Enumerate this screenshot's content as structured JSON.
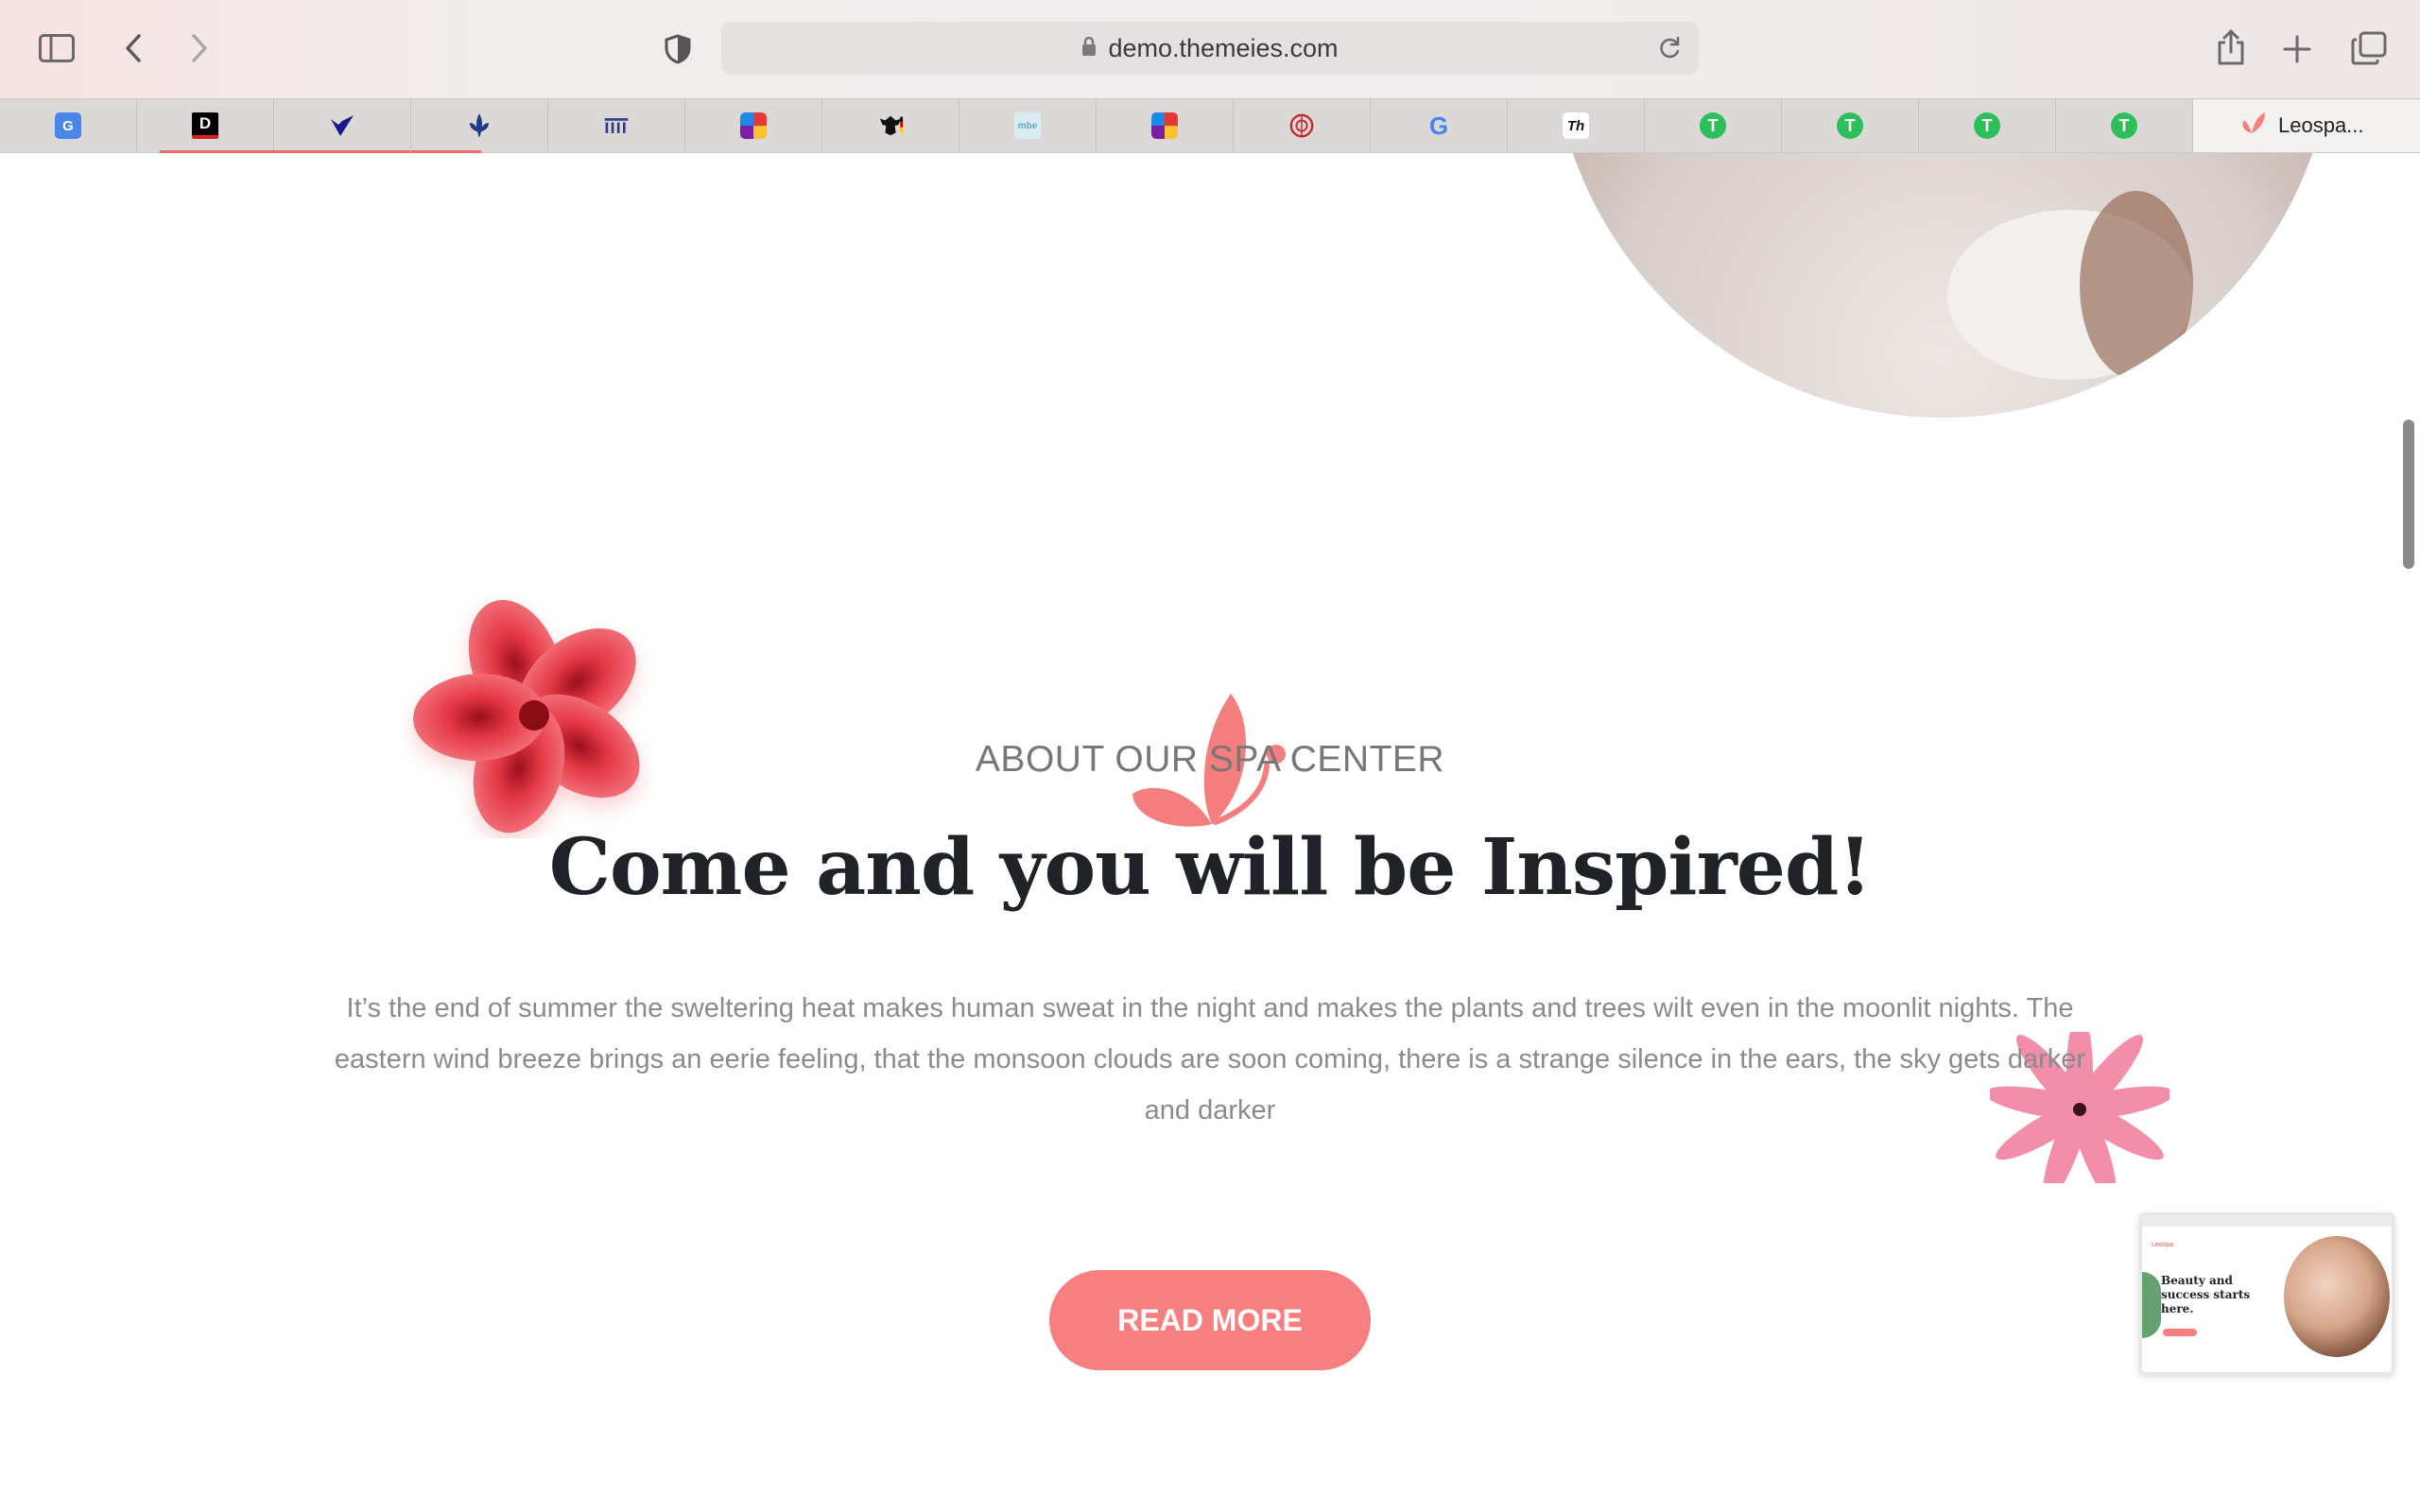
{
  "browser": {
    "url": "demo.themeies.com",
    "active_tab_label": "Leospa...",
    "tabs": [
      {
        "icon": "google-translate-icon",
        "text": "G"
      },
      {
        "icon": "d-logo-icon",
        "text": "D"
      },
      {
        "icon": "check-logo-icon",
        "text": ""
      },
      {
        "icon": "fleur-logo-icon",
        "text": ""
      },
      {
        "icon": "columns-logo-icon",
        "text": ""
      },
      {
        "icon": "grid-logo-icon",
        "text": ""
      },
      {
        "icon": "eagle-logo-icon",
        "text": ""
      },
      {
        "icon": "mbe-logo-icon",
        "text": ""
      },
      {
        "icon": "grid-logo-icon",
        "text": ""
      },
      {
        "icon": "seal-logo-icon",
        "text": ""
      },
      {
        "icon": "google-icon",
        "text": "G"
      },
      {
        "icon": "th-logo-icon",
        "text": "Th"
      },
      {
        "icon": "t-green-icon",
        "text": "T"
      },
      {
        "icon": "t-green-icon",
        "text": "T"
      },
      {
        "icon": "t-green-icon",
        "text": "T"
      },
      {
        "icon": "t-green-icon",
        "text": "T"
      }
    ]
  },
  "about": {
    "eyebrow": "ABOUT OUR SPA CENTER",
    "headline": "Come and you will be Inspired!",
    "body": "It’s the end of summer the sweltering heat makes human sweat in the night and makes the plants and trees wilt even in the moonlit nights. The eastern wind breeze brings an eerie feeling, that the monsoon clouds are soon coming, there is a strange silence in the ears, the sky gets darker and darker",
    "button": "READ MORE"
  },
  "thumbnail": {
    "brand": "Leospa",
    "headline": "Beauty and success starts here."
  },
  "colors": {
    "accent": "#f77f7f",
    "heading": "#1f2327",
    "body": "#8b8b8b"
  }
}
